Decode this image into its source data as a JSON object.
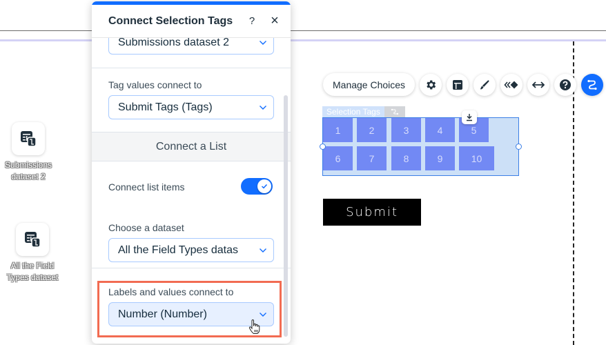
{
  "stage": {
    "datasets": [
      {
        "label_line1": "Submissions",
        "label_line2": "dataset 2",
        "icon": "dataset-icon"
      },
      {
        "label_line1": "All the Field",
        "label_line2": "Types dataset",
        "icon": "dataset-icon"
      }
    ]
  },
  "panel": {
    "title": "Connect Selection Tags",
    "help_icon": "?",
    "close_icon": "×",
    "dataset_dropdown": {
      "value": "Submissions dataset 2"
    },
    "tag_values": {
      "label": "Tag values connect to",
      "value": "Submit Tags (Tags)"
    },
    "list_section_title": "Connect a List",
    "connect_list_items": {
      "label": "Connect list items",
      "enabled": true
    },
    "choose_dataset": {
      "label": "Choose a dataset",
      "value": "All the Field Types datas"
    },
    "labels_values": {
      "label": "Labels and values connect to",
      "value": "Number (Number)"
    }
  },
  "toolbar": {
    "manage_choices_label": "Manage Choices",
    "icons": [
      "settings-icon",
      "layout-icon",
      "design-icon",
      "animation-icon",
      "stretch-icon",
      "help-icon",
      "connect-data-icon"
    ]
  },
  "component": {
    "name_tag": "Selection Tags",
    "tags": [
      "1",
      "2",
      "3",
      "4",
      "5",
      "6",
      "7",
      "8",
      "9",
      "10"
    ],
    "submit_label": "Submit"
  },
  "colors": {
    "accent": "#116dff",
    "highlight": "#f26b52",
    "tag_fill": "#7289f4"
  }
}
